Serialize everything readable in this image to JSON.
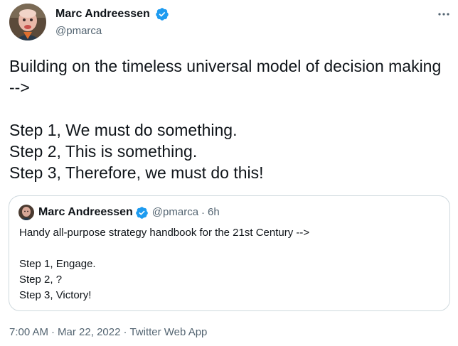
{
  "author": {
    "name": "Marc Andreessen",
    "handle": "@pmarca"
  },
  "tweet": {
    "lines_intro": "Building on the timeless universal model of decision making -->",
    "step1": "Step 1, We must do something.",
    "step2": "Step 2, This is something.",
    "step3": "Step 3, Therefore, we must do this!"
  },
  "quoted_tweet": {
    "name": "Marc Andreessen",
    "handle": "@pmarca",
    "separator": "·",
    "time": "6h",
    "intro": "Handy all-purpose strategy handbook for the 21st Century -->",
    "step1": "Step 1, Engage.",
    "step2": "Step 2, ?",
    "step3": "Step 3, Victory!"
  },
  "meta": {
    "time": "7:00 AM",
    "date": "Mar 22, 2022",
    "source": "Twitter Web App",
    "separator": "·"
  },
  "icons": {
    "verified": "verified-badge-icon",
    "more": "more-options-icon"
  },
  "colors": {
    "text": "#0f1419",
    "secondary": "#536471",
    "verified_blue": "#1d9bf0",
    "border": "#cfd9de"
  }
}
